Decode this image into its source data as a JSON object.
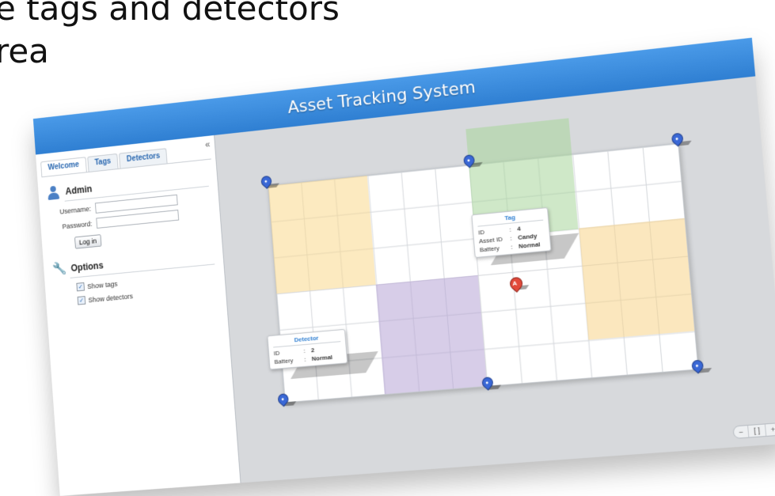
{
  "slide": {
    "line1": "e tags and detectors",
    "line2": "rea",
    "mark": ":"
  },
  "app": {
    "title": "Asset Tracking System"
  },
  "sidebar": {
    "collapse_label": "«",
    "tabs": [
      {
        "label": "Welcome"
      },
      {
        "label": "Tags"
      },
      {
        "label": "Detectors"
      }
    ],
    "admin": {
      "heading": "Admin",
      "username_label": "Username:",
      "username_value": "",
      "password_label": "Password:",
      "password_value": "",
      "login_label": "Log in"
    },
    "options": {
      "heading": "Options",
      "show_tags_label": "Show tags",
      "show_tags_checked": true,
      "show_detectors_label": "Show detectors",
      "show_detectors_checked": true
    }
  },
  "map": {
    "zone_colors": {
      "yellow": "#f9d98c",
      "green": "#a8d69a",
      "purple": "#b7a4d6",
      "orange": "#f7d488"
    },
    "tag_popup": {
      "title": "Tag",
      "id_label": "ID",
      "id_value": "4",
      "asset_label": "Asset ID",
      "asset_value": "Candy",
      "battery_label": "Battery",
      "battery_value": "Normal"
    },
    "detector_popup": {
      "title": "Detector",
      "id_label": "ID",
      "id_value": "2",
      "battery_label": "Battery",
      "battery_value": "Normal"
    },
    "tag_marker_letter": "A",
    "colon": ":"
  },
  "zoom": {
    "minus": "−",
    "fit": "[ ]",
    "plus": "+"
  }
}
